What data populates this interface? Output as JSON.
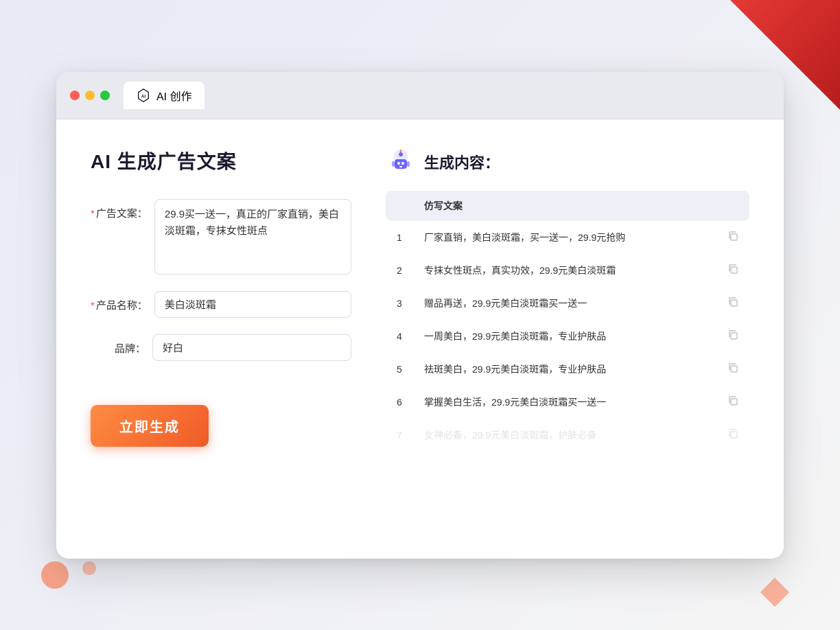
{
  "window": {
    "tab_label": "AI 创作"
  },
  "page": {
    "title": "AI 生成广告文案"
  },
  "form": {
    "ad_copy_label": "广告文案：",
    "ad_copy_required": "*",
    "ad_copy_value": "29.9买一送一，真正的厂家直销，美白淡斑霜，专抹女性斑点",
    "product_name_label": "产品名称：",
    "product_name_required": "*",
    "product_name_value": "美白淡斑霜",
    "brand_label": "品牌：",
    "brand_value": "好白",
    "generate_btn_label": "立即生成"
  },
  "result": {
    "header_title": "生成内容：",
    "table_col_header": "仿写文案",
    "items": [
      {
        "num": "1",
        "text": "厂家直销，美白淡斑霜，买一送一，29.9元抢购",
        "faded": false
      },
      {
        "num": "2",
        "text": "专抹女性斑点，真实功效，29.9元美白淡斑霜",
        "faded": false
      },
      {
        "num": "3",
        "text": "赠品再送，29.9元美白淡斑霜买一送一",
        "faded": false
      },
      {
        "num": "4",
        "text": "一周美白，29.9元美白淡斑霜，专业护肤品",
        "faded": false
      },
      {
        "num": "5",
        "text": "祛斑美白，29.9元美白淡斑霜，专业护肤品",
        "faded": false
      },
      {
        "num": "6",
        "text": "掌握美白生活，29.9元美白淡斑霜买一送一",
        "faded": false
      },
      {
        "num": "7",
        "text": "女神必备，29.9元美白淡斑霜，护肤必备",
        "faded": true
      }
    ]
  },
  "colors": {
    "accent_orange": "#f05a28",
    "accent_blue": "#5b6cf9",
    "required_red": "#ff4d4f"
  }
}
